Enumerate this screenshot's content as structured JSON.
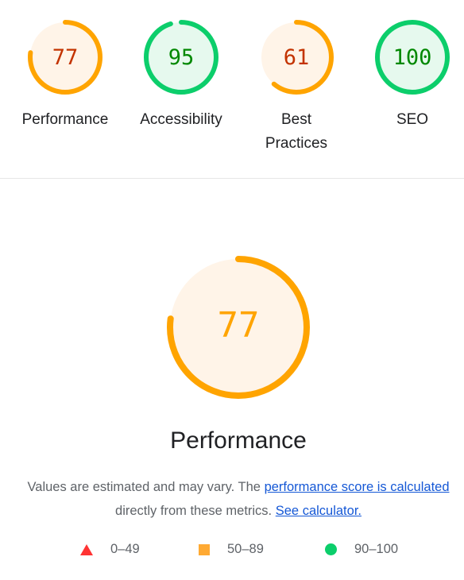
{
  "categories": [
    {
      "score": "77",
      "value": 77,
      "label": "Performance",
      "color": "#ffa400",
      "fill": "#fff4e8",
      "text_color": "#c33300"
    },
    {
      "score": "95",
      "value": 95,
      "label": "Accessibility",
      "color": "#0cce6b",
      "fill": "#e6f9ee",
      "text_color": "#008800"
    },
    {
      "score": "61",
      "value": 61,
      "label": "Best Practices",
      "color": "#ffa400",
      "fill": "#fff4e8",
      "text_color": "#c33300"
    },
    {
      "score": "100",
      "value": 100,
      "label": "SEO",
      "color": "#0cce6b",
      "fill": "#e6f9ee",
      "text_color": "#008800"
    }
  ],
  "detail": {
    "score": "77",
    "value": 77,
    "title": "Performance",
    "color": "#ffa400",
    "fill": "#fff4e8",
    "text_color": "#ffa400",
    "desc_prefix": "Values are estimated and may vary. The ",
    "link_score": "performance score is calculated",
    "desc_middle": "directly from these metrics.",
    "link_calc": "See calculator."
  },
  "legend": [
    {
      "icon": "triangle-icon",
      "range": "0–49",
      "color": "#ff3333"
    },
    {
      "icon": "square-icon",
      "range": "50–89",
      "color": "#ffaa33"
    },
    {
      "icon": "circle-icon",
      "range": "90–100",
      "color": "#0cce6b"
    }
  ]
}
